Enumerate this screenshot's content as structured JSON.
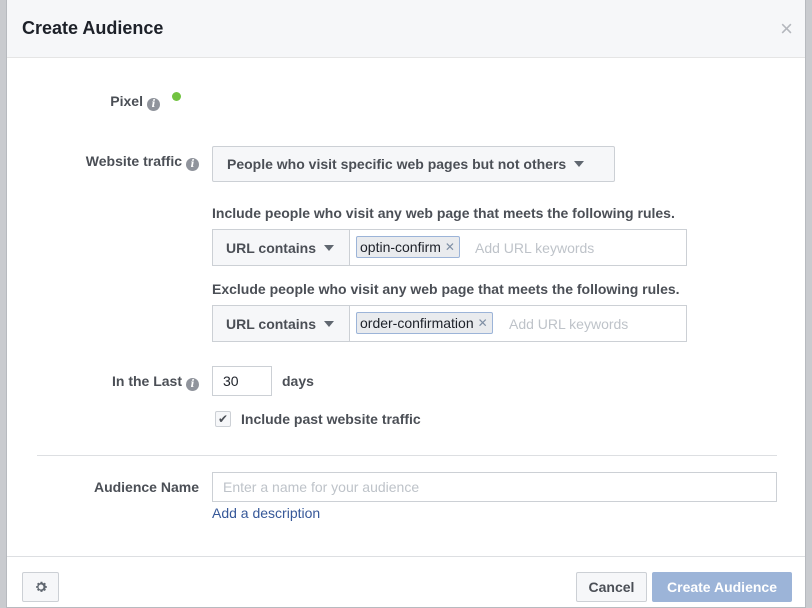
{
  "dialog": {
    "title": "Create Audience",
    "close_glyph": "×"
  },
  "pixel": {
    "label": "Pixel",
    "info_glyph": "i",
    "status_color": "#72c341"
  },
  "website_traffic": {
    "label": "Website traffic",
    "info_glyph": "i",
    "selected": "People who visit specific web pages but not others"
  },
  "include_rule": {
    "text": "Include people who visit any web page that meets the following rules.",
    "operator": "URL contains",
    "token": "optin-confirm",
    "placeholder": "Add URL keywords"
  },
  "exclude_rule": {
    "text": "Exclude people who visit any web page that meets the following rules.",
    "operator": "URL contains",
    "token": "order-confirmation",
    "placeholder": "Add URL keywords"
  },
  "in_the_last": {
    "label": "In the Last",
    "info_glyph": "i",
    "value": "30",
    "unit": "days"
  },
  "past_traffic": {
    "label": "Include past website traffic",
    "checked": true,
    "check_glyph": "✔"
  },
  "audience_name": {
    "label": "Audience Name",
    "placeholder": "Enter a name for your audience",
    "add_description": "Add a description"
  },
  "footer": {
    "settings_icon": "gear-icon",
    "cancel_label": "Cancel",
    "create_label": "Create Audience"
  },
  "colors": {
    "link": "#365899",
    "primary_disabled": "#9cb4d8",
    "token_border": "#9cb4d8"
  }
}
